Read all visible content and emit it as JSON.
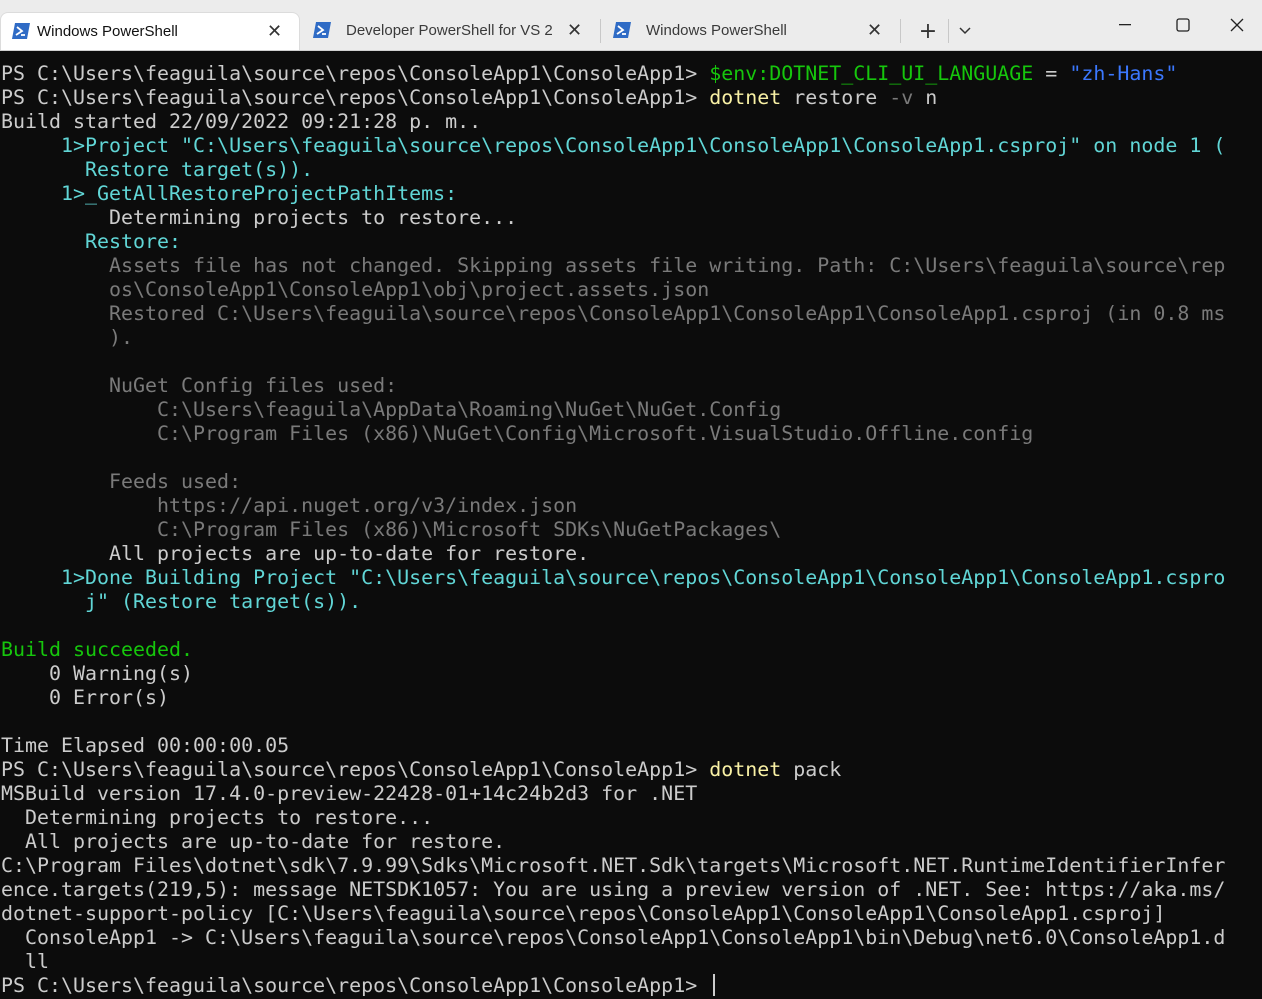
{
  "tabs": [
    {
      "label": "Windows PowerShell",
      "active": true
    },
    {
      "label": "Developer PowerShell for VS 2",
      "active": false
    },
    {
      "label": "Windows PowerShell",
      "active": false
    }
  ],
  "window_controls": {
    "new_tab": "+",
    "dropdown": "⌄",
    "minimize": "—",
    "maximize": "☐",
    "close": "✕"
  },
  "colors": {
    "background": "#0c0c0c",
    "text": "#cccccc",
    "command": "#f9f1a5",
    "variable": "#16c60c",
    "string": "#3b78ff",
    "cyan": "#61d6d6",
    "gray": "#7a7a7a",
    "success": "#16c60c",
    "tab_icon": "#2f6bc5"
  },
  "terminal": {
    "lines": [
      {
        "runs": [
          {
            "t": "PS C:\\Users\\feaguila\\source\\repos\\ConsoleApp1\\ConsoleApp1> ",
            "s": "w"
          },
          {
            "t": "$env:DOTNET_CLI_UI_LANGUAGE",
            "s": "gn"
          },
          {
            "t": " = ",
            "s": "w"
          },
          {
            "t": "\"zh-Hans\"",
            "s": "bl"
          }
        ]
      },
      {
        "runs": [
          {
            "t": "PS C:\\Users\\feaguila\\source\\repos\\ConsoleApp1\\ConsoleApp1> ",
            "s": "w"
          },
          {
            "t": "dotnet",
            "s": "y"
          },
          {
            "t": " restore ",
            "s": "w"
          },
          {
            "t": "-v",
            "s": "g"
          },
          {
            "t": " n",
            "s": "w"
          }
        ]
      },
      {
        "runs": [
          {
            "t": "Build started 22/09/2022 09:21:28 p. m..",
            "s": "w"
          }
        ]
      },
      {
        "runs": [
          {
            "t": "     1>Project \"C:\\Users\\feaguila\\source\\repos\\ConsoleApp1\\ConsoleApp1\\ConsoleApp1.csproj\" on node 1 (",
            "s": "c"
          }
        ]
      },
      {
        "runs": [
          {
            "t": "       Restore target(s)).",
            "s": "c"
          }
        ]
      },
      {
        "runs": [
          {
            "t": "     1>_GetAllRestoreProjectPathItems:",
            "s": "c"
          }
        ]
      },
      {
        "runs": [
          {
            "t": "         Determining projects to restore...",
            "s": "w"
          }
        ]
      },
      {
        "runs": [
          {
            "t": "       Restore:",
            "s": "c"
          }
        ]
      },
      {
        "runs": [
          {
            "t": "         Assets file has not changed. Skipping assets file writing. Path: C:\\Users\\feaguila\\source\\rep",
            "s": "g"
          }
        ]
      },
      {
        "runs": [
          {
            "t": "         os\\ConsoleApp1\\ConsoleApp1\\obj\\project.assets.json",
            "s": "g"
          }
        ]
      },
      {
        "runs": [
          {
            "t": "         Restored C:\\Users\\feaguila\\source\\repos\\ConsoleApp1\\ConsoleApp1\\ConsoleApp1.csproj (in 0.8 ms",
            "s": "g"
          }
        ]
      },
      {
        "runs": [
          {
            "t": "         ).",
            "s": "g"
          }
        ]
      },
      {
        "runs": [
          {
            "t": "",
            "s": "w"
          }
        ]
      },
      {
        "runs": [
          {
            "t": "         NuGet Config files used:",
            "s": "g"
          }
        ]
      },
      {
        "runs": [
          {
            "t": "             C:\\Users\\feaguila\\AppData\\Roaming\\NuGet\\NuGet.Config",
            "s": "g"
          }
        ]
      },
      {
        "runs": [
          {
            "t": "             C:\\Program Files (x86)\\NuGet\\Config\\Microsoft.VisualStudio.Offline.config",
            "s": "g"
          }
        ]
      },
      {
        "runs": [
          {
            "t": "",
            "s": "w"
          }
        ]
      },
      {
        "runs": [
          {
            "t": "         Feeds used:",
            "s": "g"
          }
        ]
      },
      {
        "runs": [
          {
            "t": "             https://api.nuget.org/v3/index.json",
            "s": "g"
          }
        ]
      },
      {
        "runs": [
          {
            "t": "             C:\\Program Files (x86)\\Microsoft SDKs\\NuGetPackages\\",
            "s": "g"
          }
        ]
      },
      {
        "runs": [
          {
            "t": "         All projects are up-to-date for restore.",
            "s": "w"
          }
        ]
      },
      {
        "runs": [
          {
            "t": "     1>Done Building Project \"C:\\Users\\feaguila\\source\\repos\\ConsoleApp1\\ConsoleApp1\\ConsoleApp1.cspro",
            "s": "c"
          }
        ]
      },
      {
        "runs": [
          {
            "t": "       j\" (Restore target(s)).",
            "s": "c"
          }
        ]
      },
      {
        "runs": [
          {
            "t": "",
            "s": "w"
          }
        ]
      },
      {
        "runs": [
          {
            "t": "Build succeeded.",
            "s": "gn"
          }
        ]
      },
      {
        "runs": [
          {
            "t": "    0 Warning(s)",
            "s": "w"
          }
        ]
      },
      {
        "runs": [
          {
            "t": "    0 Error(s)",
            "s": "w"
          }
        ]
      },
      {
        "runs": [
          {
            "t": "",
            "s": "w"
          }
        ]
      },
      {
        "runs": [
          {
            "t": "Time Elapsed 00:00:00.05",
            "s": "w"
          }
        ]
      },
      {
        "runs": [
          {
            "t": "PS C:\\Users\\feaguila\\source\\repos\\ConsoleApp1\\ConsoleApp1> ",
            "s": "w"
          },
          {
            "t": "dotnet",
            "s": "y"
          },
          {
            "t": " pack",
            "s": "w"
          }
        ]
      },
      {
        "runs": [
          {
            "t": "MSBuild version 17.4.0-preview-22428-01+14c24b2d3 for .NET",
            "s": "w"
          }
        ]
      },
      {
        "runs": [
          {
            "t": "  Determining projects to restore...",
            "s": "w"
          }
        ]
      },
      {
        "runs": [
          {
            "t": "  All projects are up-to-date for restore.",
            "s": "w"
          }
        ]
      },
      {
        "runs": [
          {
            "t": "C:\\Program Files\\dotnet\\sdk\\7.9.99\\Sdks\\Microsoft.NET.Sdk\\targets\\Microsoft.NET.RuntimeIdentifierInfer",
            "s": "w"
          }
        ]
      },
      {
        "runs": [
          {
            "t": "ence.targets(219,5): message NETSDK1057: You are using a preview version of .NET. See: https://aka.ms/",
            "s": "w"
          }
        ]
      },
      {
        "runs": [
          {
            "t": "dotnet-support-policy [C:\\Users\\feaguila\\source\\repos\\ConsoleApp1\\ConsoleApp1\\ConsoleApp1.csproj]",
            "s": "w"
          }
        ]
      },
      {
        "runs": [
          {
            "t": "  ConsoleApp1 -> C:\\Users\\feaguila\\source\\repos\\ConsoleApp1\\ConsoleApp1\\bin\\Debug\\net6.0\\ConsoleApp1.d",
            "s": "w"
          }
        ]
      },
      {
        "runs": [
          {
            "t": "  ll",
            "s": "w"
          }
        ]
      },
      {
        "runs": [
          {
            "t": "PS C:\\Users\\feaguila\\source\\repos\\ConsoleApp1\\ConsoleApp1> ",
            "s": "w"
          }
        ],
        "cursor": true
      }
    ]
  }
}
